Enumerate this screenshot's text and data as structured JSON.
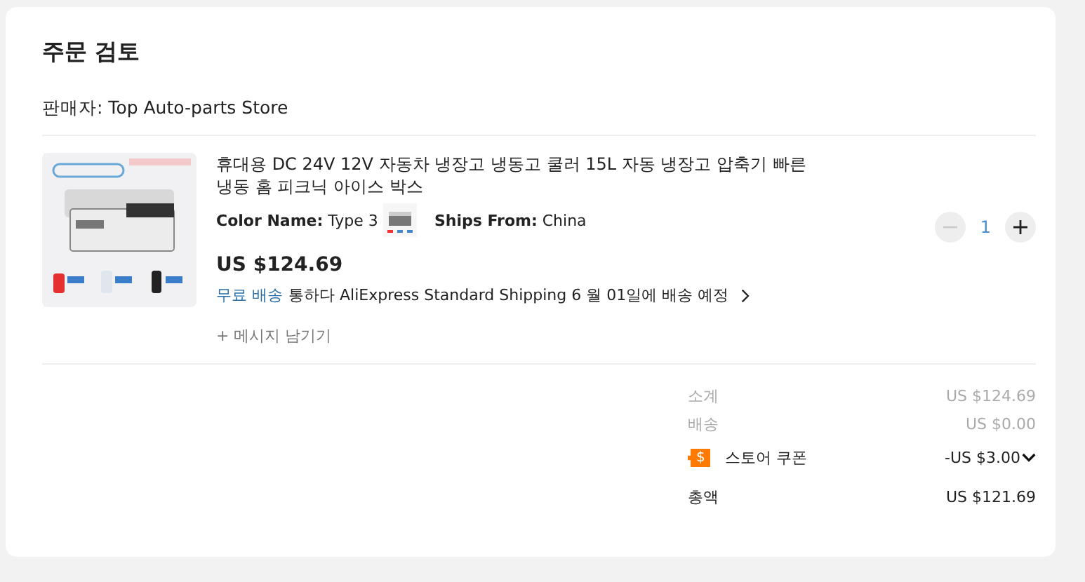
{
  "title": "주문 검토",
  "seller": "판매자: Top Auto-parts Store",
  "item": {
    "name": "휴대용 DC 24V 12V 자동차 냉장고 냉동고 쿨러 15L 자동 냉장고 압축기 빠른 냉동 홈 피크닉 아이스 박스",
    "color_label": "Color Name:",
    "color_value": "Type 3",
    "ships_label": "Ships From:",
    "ships_value": "China",
    "price": "US $124.69",
    "shipping_free": "무료 배송",
    "shipping_text": "통하다 AliExpress Standard Shipping 6 월 01일에 배송 예정",
    "message": "+ 메시지 남기기",
    "quantity": "1",
    "minus_disabled": true,
    "plus_disabled": false
  },
  "summary": [
    {
      "kind": "muted",
      "label": "소계",
      "value": "US $124.69"
    },
    {
      "kind": "muted",
      "label": "배송",
      "value": "US $0.00"
    },
    {
      "kind": "coupon",
      "icon": "$",
      "label": "스토어 쿠폰",
      "value": "-US $3.00"
    },
    {
      "kind": "total",
      "label": "총액",
      "value": "US $121.69"
    }
  ]
}
